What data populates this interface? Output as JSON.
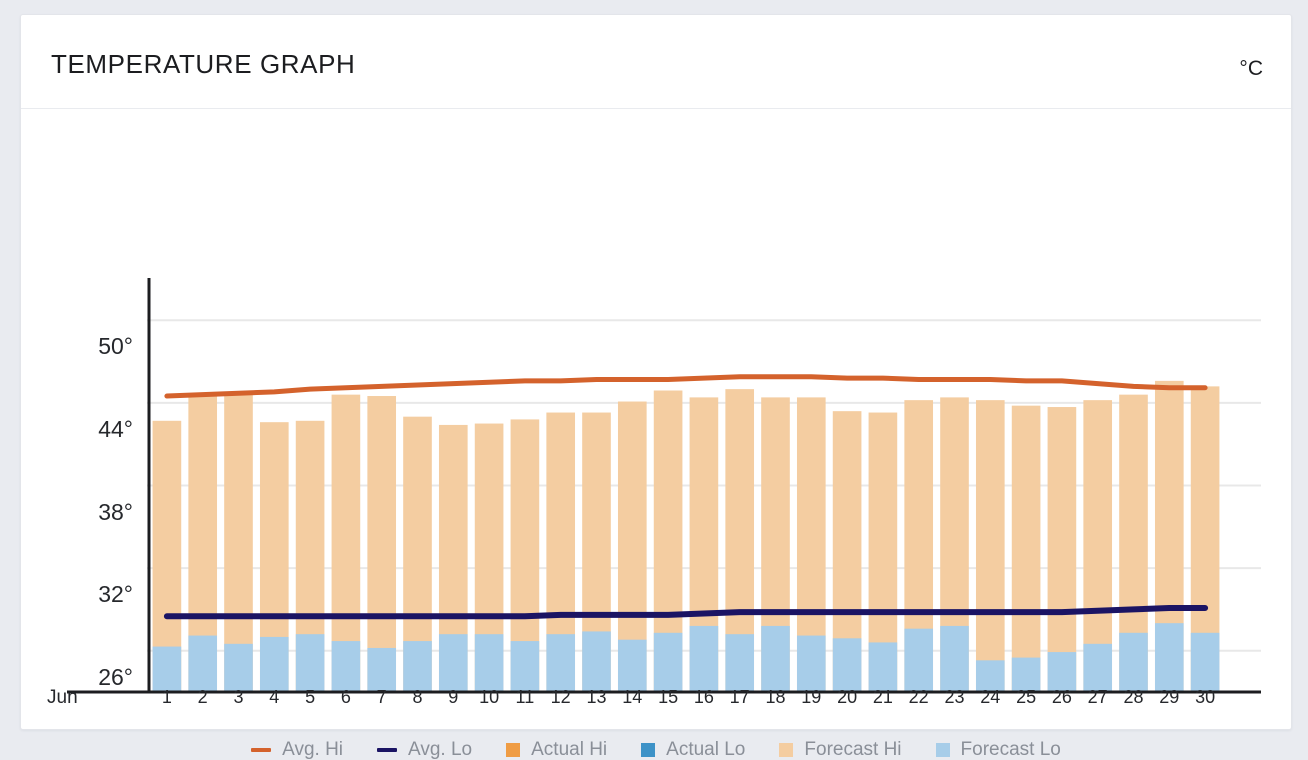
{
  "header": {
    "title": "TEMPERATURE GRAPH",
    "unit": "°C"
  },
  "legend": {
    "items": [
      {
        "label": "Avg. Hi",
        "marker": "line",
        "color": "#d4622c"
      },
      {
        "label": "Avg. Lo",
        "marker": "line",
        "color": "#1b1464"
      },
      {
        "label": "Actual Hi",
        "marker": "box",
        "color": "#ef9c44"
      },
      {
        "label": "Actual Lo",
        "marker": "box",
        "color": "#3d92c7"
      },
      {
        "label": "Forecast Hi",
        "marker": "box",
        "color": "#f4cda1"
      },
      {
        "label": "Forecast Lo",
        "marker": "box",
        "color": "#a7cde9"
      }
    ]
  },
  "chart_data": {
    "type": "bar",
    "title": "TEMPERATURE GRAPH",
    "subtitle": "",
    "xlabel": "Jun",
    "ylabel": "°C",
    "month_label": "Jun",
    "ylim": [
      23,
      53
    ],
    "yticks": [
      26,
      32,
      38,
      44,
      50
    ],
    "ytick_labels": [
      "26°",
      "32°",
      "38°",
      "44°",
      "50°"
    ],
    "grid": true,
    "legend_position": "bottom",
    "categories": [
      "1",
      "2",
      "3",
      "4",
      "5",
      "6",
      "7",
      "8",
      "9",
      "10",
      "11",
      "12",
      "13",
      "14",
      "15",
      "16",
      "17",
      "18",
      "19",
      "20",
      "21",
      "22",
      "23",
      "24",
      "25",
      "26",
      "27",
      "28",
      "29",
      "30"
    ],
    "series": [
      {
        "name": "Forecast Hi",
        "type": "bar",
        "color": "#f4cda1",
        "values": [
          42.7,
          44.5,
          44.6,
          42.6,
          42.7,
          44.6,
          44.5,
          43.0,
          42.4,
          42.5,
          42.8,
          43.3,
          43.3,
          44.1,
          44.9,
          44.4,
          45.0,
          44.4,
          44.4,
          43.4,
          43.3,
          44.2,
          44.4,
          44.2,
          43.8,
          43.7,
          44.2,
          44.6,
          45.6,
          45.2
        ]
      },
      {
        "name": "Forecast Lo",
        "type": "bar",
        "color": "#a7cde9",
        "values": [
          26.3,
          27.1,
          26.5,
          27.0,
          27.2,
          26.7,
          26.2,
          26.7,
          27.2,
          27.2,
          26.7,
          27.2,
          27.4,
          26.8,
          27.3,
          27.8,
          27.2,
          27.8,
          27.1,
          26.9,
          26.6,
          27.6,
          27.8,
          25.3,
          25.5,
          25.9,
          26.5,
          27.3,
          28.0,
          27.3
        ]
      },
      {
        "name": "Avg. Hi",
        "type": "line",
        "color": "#d4622c",
        "values": [
          44.5,
          44.6,
          44.7,
          44.8,
          45.0,
          45.1,
          45.2,
          45.3,
          45.4,
          45.5,
          45.6,
          45.6,
          45.7,
          45.7,
          45.7,
          45.8,
          45.9,
          45.9,
          45.9,
          45.8,
          45.8,
          45.7,
          45.7,
          45.7,
          45.6,
          45.6,
          45.4,
          45.2,
          45.1,
          45.1
        ]
      },
      {
        "name": "Avg. Lo",
        "type": "line",
        "color": "#1b1464",
        "values": [
          28.5,
          28.5,
          28.5,
          28.5,
          28.5,
          28.5,
          28.5,
          28.5,
          28.5,
          28.5,
          28.5,
          28.6,
          28.6,
          28.6,
          28.6,
          28.7,
          28.8,
          28.8,
          28.8,
          28.8,
          28.8,
          28.8,
          28.8,
          28.8,
          28.8,
          28.8,
          28.9,
          29.0,
          29.1,
          29.1
        ]
      }
    ]
  }
}
